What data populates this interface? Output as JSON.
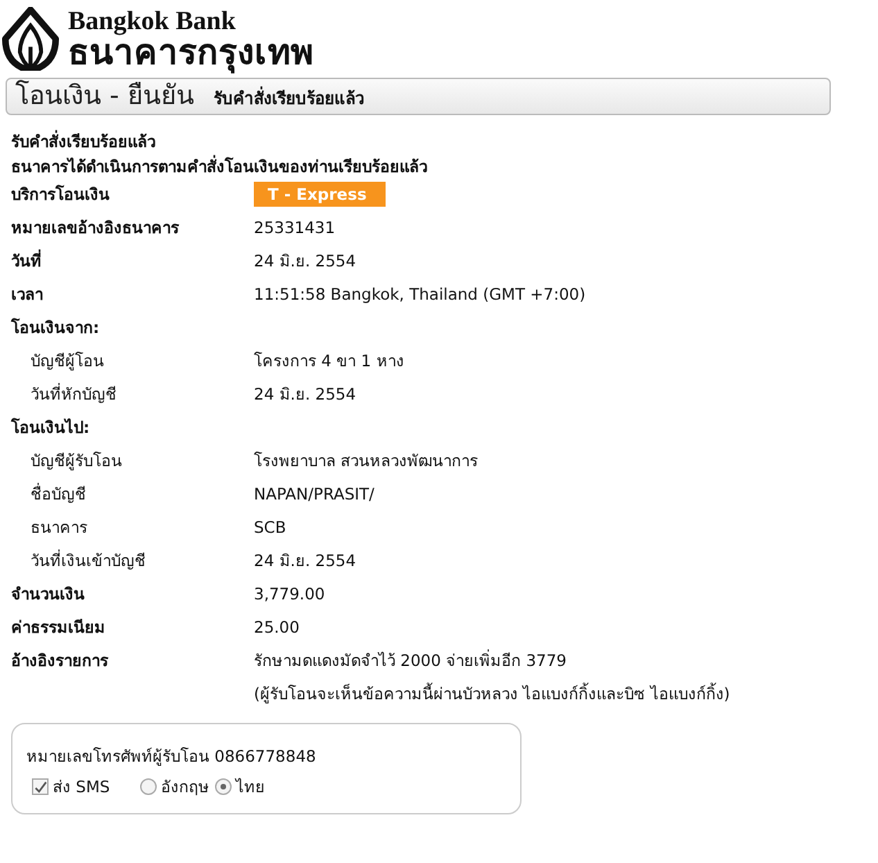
{
  "logo": {
    "name_en": "Bangkok Bank",
    "name_th": "ธนาคารกรุงเทพ"
  },
  "header": {
    "title": "โอนเงิน - ยืนยัน",
    "subtitle": "รับคำสั่งเรียบร้อยแล้ว"
  },
  "status": {
    "title": "รับคำสั่งเรียบร้อยแล้ว",
    "message": "ธนาคารได้ดำเนินการตามคำสั่งโอนเงินของท่านเรียบร้อยแล้ว"
  },
  "details": [
    {
      "kind": "badge",
      "label": "บริการโอนเงิน",
      "values": [
        "T - Express"
      ]
    },
    {
      "kind": "row",
      "label": "หมายเลขอ้างอิงธนาคาร",
      "values": [
        "25331431"
      ]
    },
    {
      "kind": "row",
      "label": "วันที่",
      "values": [
        "24 มิ.ย. 2554"
      ]
    },
    {
      "kind": "row",
      "label": "เวลา",
      "values": [
        "11:51:58 Bangkok, Thailand (GMT +7:00)"
      ]
    },
    {
      "kind": "section",
      "label": "โอนเงินจาก:"
    },
    {
      "kind": "sub",
      "label": "บัญชีผู้โอน",
      "values": [
        "โครงการ 4 ขา 1 หาง"
      ]
    },
    {
      "kind": "sub",
      "label": "วันที่หักบัญชี",
      "values": [
        "24 มิ.ย. 2554"
      ]
    },
    {
      "kind": "section",
      "label": "โอนเงินไป:"
    },
    {
      "kind": "sub",
      "label": "บัญชีผู้รับโอน",
      "values": [
        "โรงพยาบาล สวนหลวงพัฒนาการ"
      ]
    },
    {
      "kind": "sub",
      "label": "ชื่อบัญชี",
      "values": [
        "NAPAN/PRASIT/"
      ]
    },
    {
      "kind": "sub",
      "label": "ธนาคาร",
      "values": [
        "SCB"
      ]
    },
    {
      "kind": "sub",
      "label": "วันที่เงินเข้าบัญชี",
      "values": [
        "24 มิ.ย. 2554"
      ]
    },
    {
      "kind": "row",
      "label": "จำนวนเงิน",
      "values": [
        "3,779.00"
      ]
    },
    {
      "kind": "row",
      "label": "ค่าธรรมเนียม",
      "values": [
        "25.00"
      ]
    },
    {
      "kind": "row",
      "label": "อ้างอิงรายการ",
      "values": [
        "รักษามดแดงมัดจำไว้ 2000 จ่ายเพิ่มอีก 3779",
        "(ผู้รับโอนจะเห็นข้อความนี้ผ่านบัวหลวง ไอแบงก์กิ้งและบิซ ไอแบงก์กิ้ง)"
      ]
    }
  ],
  "sms": {
    "phone_text": "หมายเลขโทรศัพท์ผู้รับโอน 0866778848",
    "send": {
      "label": "ส่ง SMS",
      "checked": true
    },
    "languages": [
      {
        "label": "อังกฤษ",
        "selected": false
      },
      {
        "label": "ไทย",
        "selected": true
      }
    ]
  }
}
